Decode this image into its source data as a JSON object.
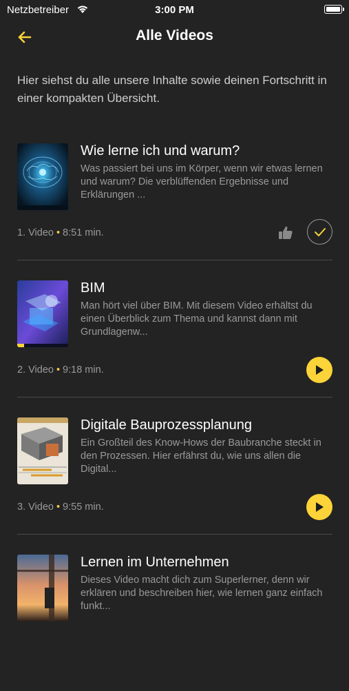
{
  "status": {
    "carrier": "Netzbetreiber",
    "time": "3:00 PM"
  },
  "nav": {
    "title": "Alle Videos"
  },
  "intro": "Hier siehst du alle unsere Inhalte sowie deinen Fortschritt in einer kompakten Übersicht.",
  "accent_color": "#fcd338",
  "videos": [
    {
      "title": "Wie lerne ich und warum?",
      "description": "Was passiert bei uns im Körper, wenn wir etwas lernen und warum? Die verblüffenden Ergebnisse und Erklärungen ...",
      "number": "1. Video",
      "duration": "8:51 min.",
      "status": "completed"
    },
    {
      "title": "BIM",
      "description": "Man hört viel über BIM. Mit diesem Video erhältst du einen Überblick zum Thema und kannst dann mit Grundlagenw...",
      "number": "2. Video",
      "duration": "9:18 min.",
      "status": "play"
    },
    {
      "title": "Digitale Bauprozessplanung",
      "description": "Ein Großteil des Know-Hows der Baubranche steckt in den Prozessen. Hier erfährst du, wie uns allen die Digital...",
      "number": "3. Video",
      "duration": "9:55 min.",
      "status": "play"
    },
    {
      "title": "Lernen im Unternehmen",
      "description": "Dieses Video macht dich zum Superlerner, denn wir erklären und beschreiben hier, wie lernen ganz einfach funkt...",
      "number": "",
      "duration": "",
      "status": "play"
    }
  ]
}
